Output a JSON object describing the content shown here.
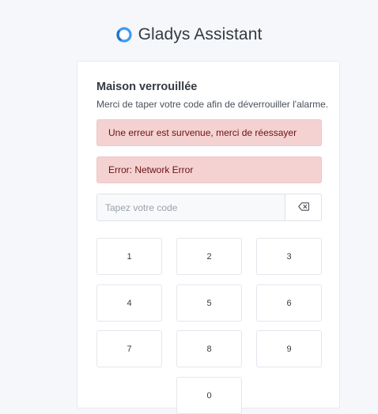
{
  "brand": {
    "title": "Gladys Assistant",
    "logo_icon": "gladys-logo-icon",
    "logo_color": "#3b9bf1"
  },
  "card": {
    "title": "Maison verrouillée",
    "description": "Merci de taper votre code afin de déverrouiller l'alarme."
  },
  "alerts": [
    {
      "text": "Une erreur est survenue, merci de réessayer"
    },
    {
      "text": "Error: Network Error"
    }
  ],
  "code_input": {
    "value": "",
    "placeholder": "Tapez votre code",
    "clear_icon": "backspace-icon"
  },
  "keypad": {
    "keys": [
      "1",
      "2",
      "3",
      "4",
      "5",
      "6",
      "7",
      "8",
      "9",
      "0"
    ]
  },
  "colors": {
    "alert_bg": "#f5d2d2",
    "alert_text": "#6b1110",
    "page_bg": "#f5f7fb"
  }
}
